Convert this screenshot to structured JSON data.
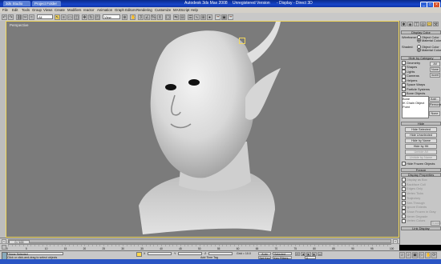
{
  "titlebar": {
    "app_tab": "3ds Studio Max",
    "project_tab": "Project Folder",
    "title": "Autodesk 3ds Max 2008",
    "subtitle": "Unregistered Version",
    "display": "- Display - Direct 3D",
    "min_glyph": "_",
    "max_glyph": "□",
    "close_glyph": "×"
  },
  "menus": [
    "File",
    "Edit",
    "Tools",
    "Group",
    "Views",
    "Create",
    "Modifiers",
    "reactor",
    "Animation",
    "Graph Editors",
    "Rendering",
    "Customize",
    "MAXScript",
    "Help"
  ],
  "toolbar": {
    "selection_filter": "All",
    "coord_system": "View"
  },
  "viewport": {
    "label": "Perspective"
  },
  "right_panel": {
    "display_color": {
      "header": "Display Color",
      "wireframe_label": "Wireframe:",
      "shaded_label": "Shaded:",
      "object_color": "Object Color",
      "material_color": "Material Color"
    },
    "hide_by_category": {
      "header": "Hide by Category",
      "items": [
        "Geometry",
        "Shapes",
        "Lights",
        "Cameras",
        "Helpers",
        "Space Warps",
        "Particle Systems",
        "Bone Objects"
      ],
      "buttons": [
        "All",
        "None",
        "Invert"
      ],
      "list_header": "Bone",
      "list_items": [
        "IK Chain Object",
        "Point"
      ],
      "add_btn": "Add...",
      "remove_btn": "Remove",
      "none_btn": "None"
    },
    "hide": {
      "header": "Hide",
      "buttons": [
        "Hide Selected",
        "Hide Unselected",
        "Hide by Name",
        "Hide by Hit",
        "Unhide All",
        "Unhide by Name"
      ],
      "checkbox": "Hide Frozen Objects"
    },
    "freeze_header": "Freeze",
    "display_properties": {
      "header": "Display Properties",
      "items": [
        "Display as Box",
        "Backface Cull",
        "Edges Only",
        "Vertex Ticks",
        "Trajectory",
        "See-Through",
        "Ignore Extents",
        "Show Frozen in Gray",
        "Never Degrade",
        "Vertex Colors"
      ],
      "shaded_btn": "Shaded"
    },
    "link_display": "Link Display"
  },
  "timeline": {
    "frame_label": "0 / 100",
    "prev": "<",
    "next": ">",
    "ticks": [
      "0",
      "5",
      "10",
      "15",
      "20",
      "25",
      "30",
      "35",
      "40",
      "45",
      "50",
      "55",
      "60",
      "65",
      "70",
      "75",
      "80",
      "85",
      "90",
      "95",
      "100"
    ]
  },
  "status": {
    "selection": "None Selected",
    "prompt": "Click or click-and-drag to select objects",
    "x_label": "X",
    "y_label": "Y",
    "z_label": "Z",
    "grid": "Grid = 10.0",
    "add_time_tag": "Add Time Tag",
    "auto_key": "Auto Key",
    "set_key": "Set Key",
    "selected": "Selected",
    "key_filters": "Key Filters...",
    "frame": "0"
  },
  "colors": {
    "viewport_bg": "#7b7b7b",
    "active_border": "#f3d95c",
    "ui_gray": "#c8c8c8",
    "title_blue": "#1744c8"
  }
}
